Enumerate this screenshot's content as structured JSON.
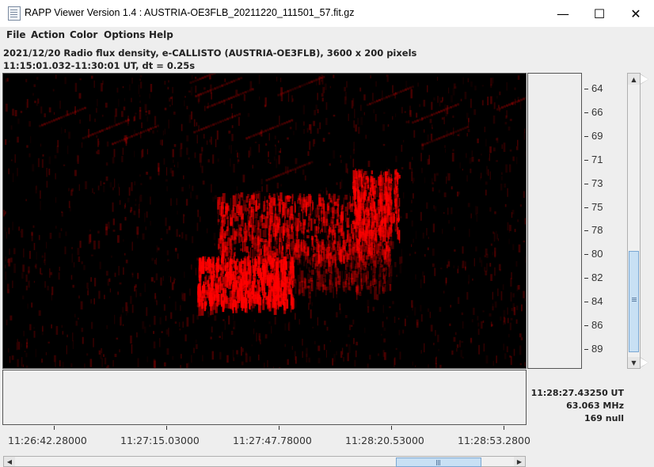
{
  "window": {
    "title": "RAPP Viewer Version 1.4 : AUSTRIA-OE3FLB_20211220_111501_57.fit.gz",
    "minimize_glyph": "—",
    "maximize_glyph": "☐",
    "close_glyph": "✕"
  },
  "menu": [
    "File",
    "Action",
    "Color",
    "Options",
    "Help"
  ],
  "info": {
    "line1": "2021/12/20  Radio flux density, e-CALLISTO (AUSTRIA-OE3FLB),  3600 x 200 pixels",
    "line2": "11:15:01.032-11:30:01 UT,  dt = 0.25s"
  },
  "chart_data": {
    "type": "heatmap",
    "colormap": [
      "#000000",
      "#ff0000"
    ],
    "y_axis": {
      "label": "",
      "unit": "MHz",
      "tick_labels": [
        "64",
        "66",
        "69",
        "71",
        "73",
        "75",
        "78",
        "80",
        "82",
        "84",
        "86",
        "89"
      ]
    },
    "x_axis": {
      "label": "",
      "tick_labels": [
        "11:26:42.28000",
        "11:27:15.03000",
        "11:27:47.78000",
        "11:28:20.53000",
        "11:28:53.2800"
      ]
    }
  },
  "readout": {
    "time": "11:28:27.43250 UT",
    "frequency": "63.063 MHz",
    "value": "169 null"
  },
  "scroll": {
    "up_arrow": "▲",
    "down_arrow": "▼",
    "left_arrow": "◀",
    "right_arrow": "▶"
  }
}
